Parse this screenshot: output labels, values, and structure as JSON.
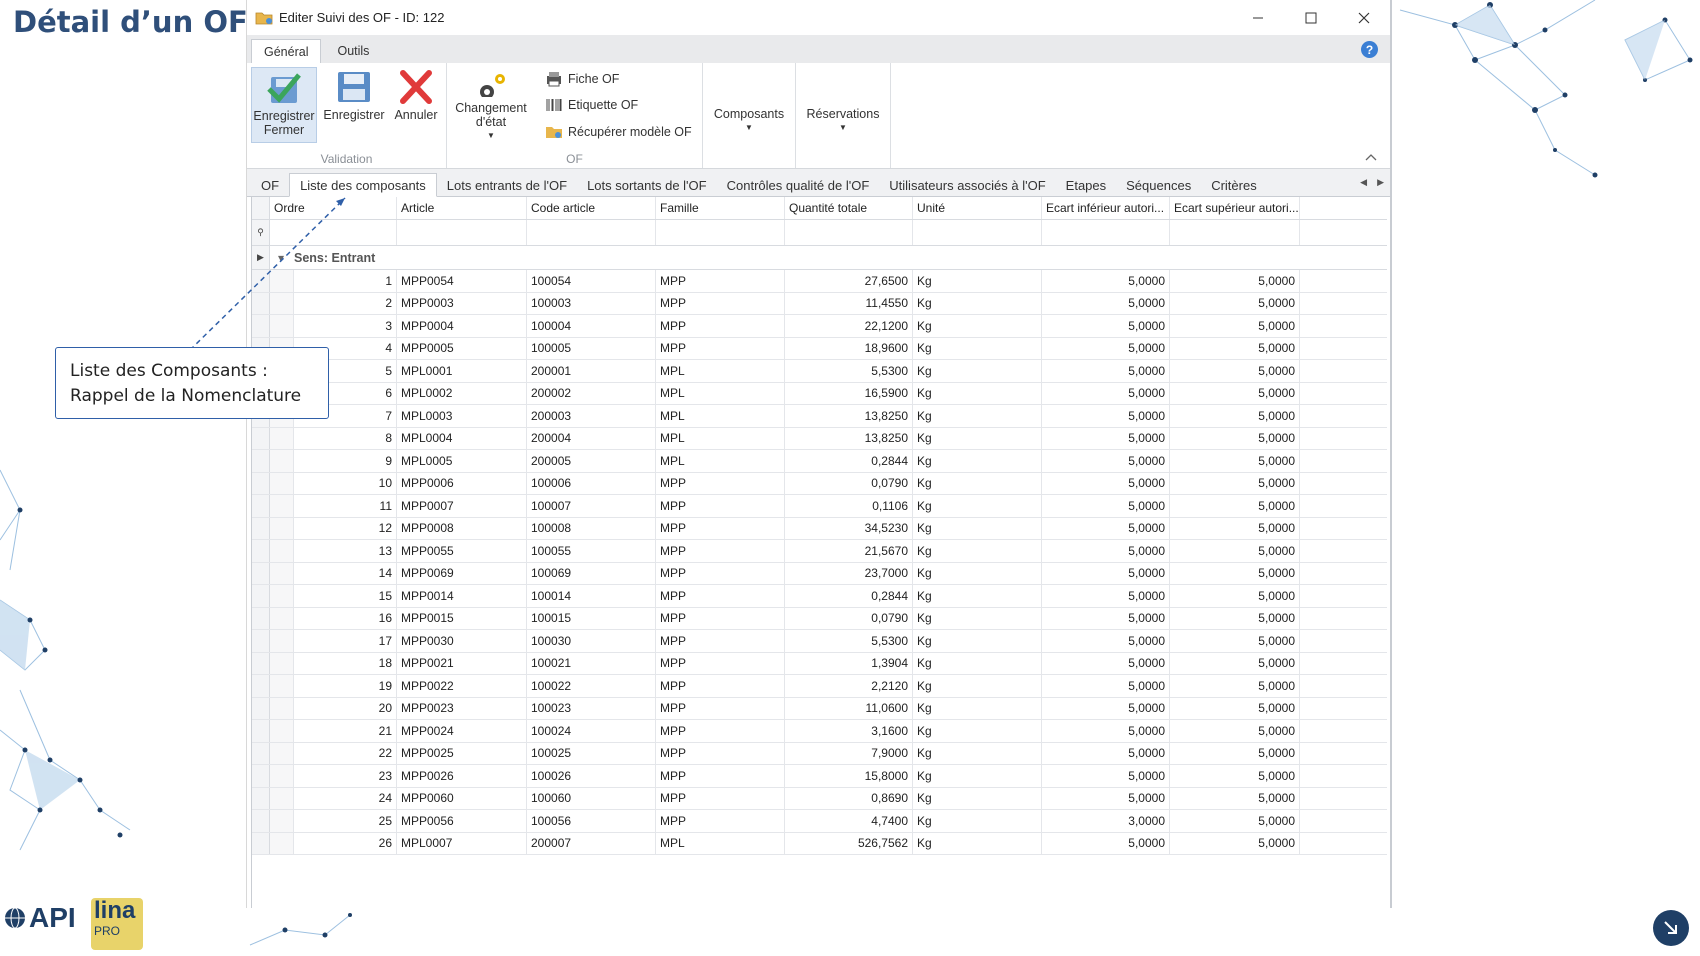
{
  "slide": {
    "title": "Détail d’un OF",
    "callout_line1": "Liste des Composants :",
    "callout_line2": "Rappel de la Nomenclature",
    "logo_api": "API",
    "logo_lina_1": "lina",
    "logo_lina_2": "PRO"
  },
  "window": {
    "title": "Editer Suivi des OF - ID: 122",
    "icon": "folder-icon",
    "controls": [
      "minimize-icon",
      "maximize-icon",
      "close-icon"
    ]
  },
  "ribbon": {
    "tabs": [
      "Général",
      "Outils"
    ],
    "active_tab": "Général",
    "groups": {
      "validation": {
        "label": "Validation",
        "save_close": [
          "Enregistrer",
          "Fermer"
        ],
        "save": "Enregistrer",
        "cancel": "Annuler"
      },
      "of": {
        "label": "OF",
        "change_state": [
          "Changement",
          "d'état"
        ],
        "fiche_of": "Fiche OF",
        "etiquette_of": "Etiquette OF",
        "recuperer_modele": "Récupérer modèle OF"
      },
      "composants": "Composants",
      "reservations": "Réservations"
    }
  },
  "subtabs": [
    "OF",
    "Liste des composants",
    "Lots entrants de l'OF",
    "Lots sortants de l'OF",
    "Contrôles qualité de l'OF",
    "Utilisateurs associés à l'OF",
    "Etapes",
    "Séquences",
    "Critères"
  ],
  "active_subtab": "Liste des composants",
  "grid": {
    "columns": [
      "Ordre",
      "Article",
      "Code article",
      "Famille",
      "Quantité totale",
      "Unité",
      "Ecart inférieur autori...",
      "Ecart supérieur autori..."
    ],
    "group_label": "Sens: Entrant",
    "rows": [
      [
        "1",
        "MPP0054",
        "100054",
        "MPP",
        "27,6500",
        "Kg",
        "5,0000",
        "5,0000"
      ],
      [
        "2",
        "MPP0003",
        "100003",
        "MPP",
        "11,4550",
        "Kg",
        "5,0000",
        "5,0000"
      ],
      [
        "3",
        "MPP0004",
        "100004",
        "MPP",
        "22,1200",
        "Kg",
        "5,0000",
        "5,0000"
      ],
      [
        "4",
        "MPP0005",
        "100005",
        "MPP",
        "18,9600",
        "Kg",
        "5,0000",
        "5,0000"
      ],
      [
        "5",
        "MPL0001",
        "200001",
        "MPL",
        "5,5300",
        "Kg",
        "5,0000",
        "5,0000"
      ],
      [
        "6",
        "MPL0002",
        "200002",
        "MPL",
        "16,5900",
        "Kg",
        "5,0000",
        "5,0000"
      ],
      [
        "7",
        "MPL0003",
        "200003",
        "MPL",
        "13,8250",
        "Kg",
        "5,0000",
        "5,0000"
      ],
      [
        "8",
        "MPL0004",
        "200004",
        "MPL",
        "13,8250",
        "Kg",
        "5,0000",
        "5,0000"
      ],
      [
        "9",
        "MPL0005",
        "200005",
        "MPL",
        "0,2844",
        "Kg",
        "5,0000",
        "5,0000"
      ],
      [
        "10",
        "MPP0006",
        "100006",
        "MPP",
        "0,0790",
        "Kg",
        "5,0000",
        "5,0000"
      ],
      [
        "11",
        "MPP0007",
        "100007",
        "MPP",
        "0,1106",
        "Kg",
        "5,0000",
        "5,0000"
      ],
      [
        "12",
        "MPP0008",
        "100008",
        "MPP",
        "34,5230",
        "Kg",
        "5,0000",
        "5,0000"
      ],
      [
        "13",
        "MPP0055",
        "100055",
        "MPP",
        "21,5670",
        "Kg",
        "5,0000",
        "5,0000"
      ],
      [
        "14",
        "MPP0069",
        "100069",
        "MPP",
        "23,7000",
        "Kg",
        "5,0000",
        "5,0000"
      ],
      [
        "15",
        "MPP0014",
        "100014",
        "MPP",
        "0,2844",
        "Kg",
        "5,0000",
        "5,0000"
      ],
      [
        "16",
        "MPP0015",
        "100015",
        "MPP",
        "0,0790",
        "Kg",
        "5,0000",
        "5,0000"
      ],
      [
        "17",
        "MPP0030",
        "100030",
        "MPP",
        "5,5300",
        "Kg",
        "5,0000",
        "5,0000"
      ],
      [
        "18",
        "MPP0021",
        "100021",
        "MPP",
        "1,3904",
        "Kg",
        "5,0000",
        "5,0000"
      ],
      [
        "19",
        "MPP0022",
        "100022",
        "MPP",
        "2,2120",
        "Kg",
        "5,0000",
        "5,0000"
      ],
      [
        "20",
        "MPP0023",
        "100023",
        "MPP",
        "11,0600",
        "Kg",
        "5,0000",
        "5,0000"
      ],
      [
        "21",
        "MPP0024",
        "100024",
        "MPP",
        "3,1600",
        "Kg",
        "5,0000",
        "5,0000"
      ],
      [
        "22",
        "MPP0025",
        "100025",
        "MPP",
        "7,9000",
        "Kg",
        "5,0000",
        "5,0000"
      ],
      [
        "23",
        "MPP0026",
        "100026",
        "MPP",
        "15,8000",
        "Kg",
        "5,0000",
        "5,0000"
      ],
      [
        "24",
        "MPP0060",
        "100060",
        "MPP",
        "0,8690",
        "Kg",
        "5,0000",
        "5,0000"
      ],
      [
        "25",
        "MPP0056",
        "100056",
        "MPP",
        "4,7400",
        "Kg",
        "3,0000",
        "5,0000"
      ],
      [
        "26",
        "MPL0007",
        "200007",
        "MPL",
        "526,7562",
        "Kg",
        "5,0000",
        "5,0000"
      ]
    ]
  },
  "colors": {
    "title_blue": "#2f4f7a",
    "callout_border": "#2f5fa8",
    "deco_blue": "#b9d3ea"
  }
}
